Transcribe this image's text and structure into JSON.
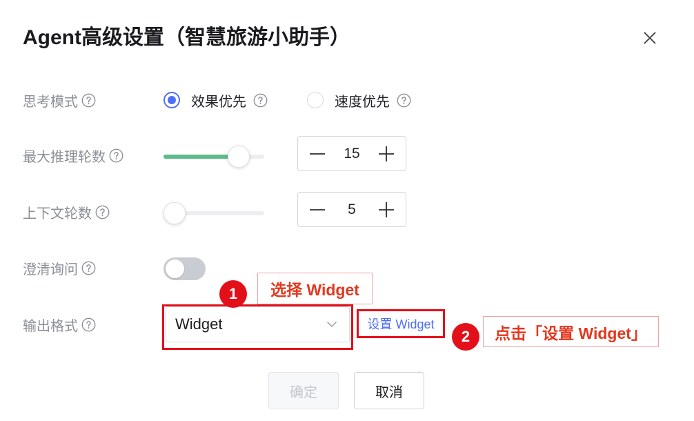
{
  "dialog": {
    "title": "Agent高级设置（智慧旅游小助手）"
  },
  "fields": {
    "thinking_mode": {
      "label": "思考模式",
      "options": [
        {
          "label": "效果优先",
          "selected": true
        },
        {
          "label": "速度优先",
          "selected": false
        }
      ]
    },
    "max_reasoning_rounds": {
      "label": "最大推理轮数",
      "slider_fraction": 0.82,
      "value": "15"
    },
    "context_rounds": {
      "label": "上下文轮数",
      "slider_fraction": 0,
      "value": "5"
    },
    "clarification": {
      "label": "澄清询问",
      "enabled": false
    },
    "output_format": {
      "label": "输出格式",
      "selected": "Widget",
      "settings_link": "设置 Widget"
    }
  },
  "annotations": [
    {
      "number": "1",
      "text": "选择 Widget"
    },
    {
      "number": "2",
      "text": "点击「设置 Widget」"
    }
  ],
  "footer": {
    "confirm_label": "确定",
    "confirm_disabled": true,
    "cancel_label": "取消"
  },
  "icons": {
    "close": "close-icon",
    "help": "help-icon",
    "minus": "minus-icon",
    "plus": "plus-icon",
    "dropdown": "chevron-down-icon"
  },
  "colors": {
    "primary": "#4f6ef7",
    "slider_fill": "#5cbb8a",
    "annotation": "#e3101a",
    "annotation_text": "#e2381f",
    "annotation_border": "#f0a3a3"
  }
}
